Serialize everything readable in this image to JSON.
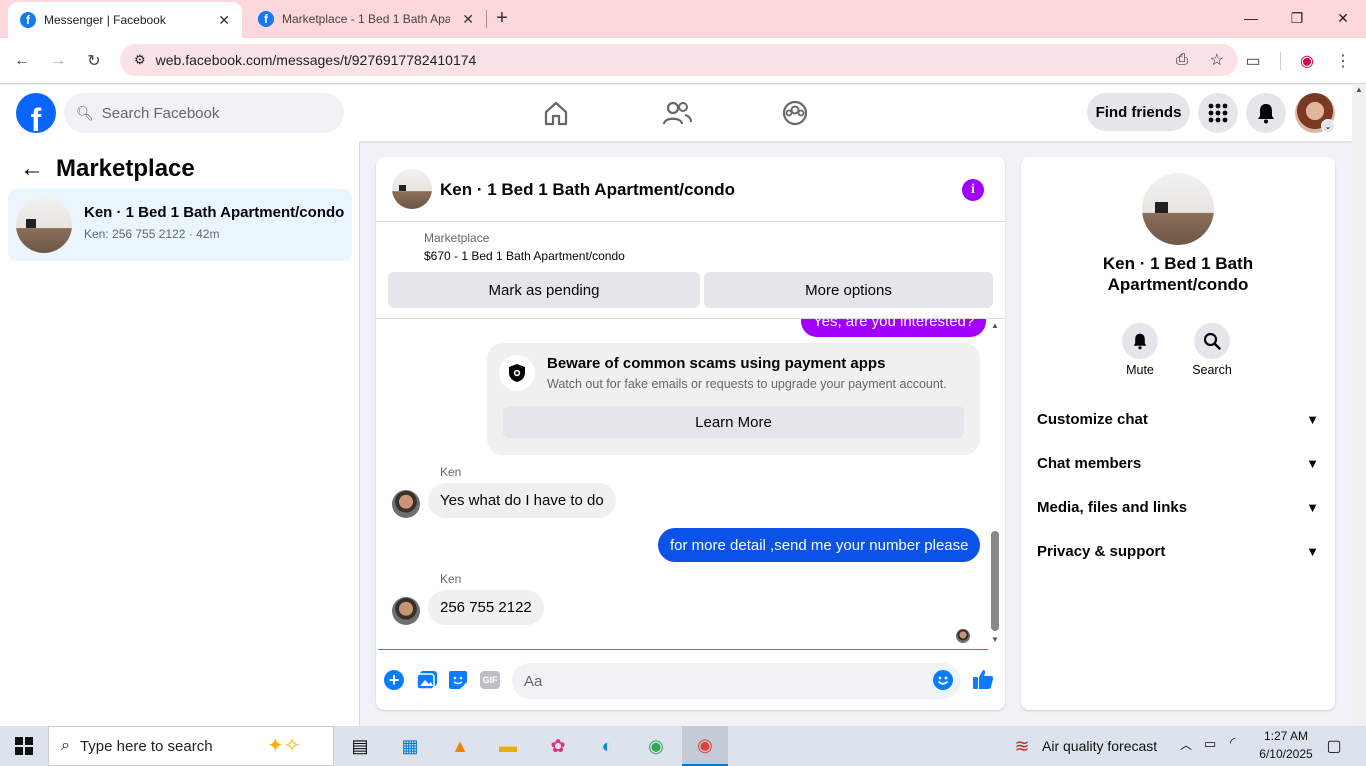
{
  "browser": {
    "tabs": [
      {
        "title": "Messenger | Facebook"
      },
      {
        "title": "Marketplace - 1 Bed 1 Bath Apa"
      }
    ],
    "url": "web.facebook.com/messages/t/9276917782410174"
  },
  "header": {
    "search_placeholder": "Search Facebook",
    "find_friends": "Find friends"
  },
  "left": {
    "title": "Marketplace",
    "conversation": {
      "name": "Ken · 1 Bed 1 Bath Apartment/condo",
      "preview": "Ken: 256 755 2122 · 42m"
    }
  },
  "chat": {
    "title": "Ken · 1 Bed 1 Bath Apartment/condo",
    "listing_source": "Marketplace",
    "listing": "$670 - 1 Bed 1 Bath Apartment/condo",
    "mark_pending": "Mark as pending",
    "more_options": "More options",
    "partial_message": "Yes, are you interested?",
    "scam_title": "Beware of common scams using payment apps",
    "scam_body": "Watch out for fake emails or requests to upgrade your payment account.",
    "learn_more": "Learn More",
    "messages": [
      {
        "sender": "Ken",
        "text": "Yes what do I have to do"
      },
      {
        "text": "for more detail ,send me your number please"
      },
      {
        "sender": "Ken",
        "text": "256 755 2122"
      }
    ],
    "composer_placeholder": "Aa",
    "composer_icons": {
      "gif": "GIF"
    }
  },
  "right": {
    "name": "Ken · 1 Bed 1 Bath Apartment/condo",
    "mute": "Mute",
    "search": "Search",
    "sections": [
      "Customize chat",
      "Chat members",
      "Media, files and links",
      "Privacy & support"
    ]
  },
  "taskbar": {
    "search_placeholder": "Type here to search",
    "weather": "Air quality forecast",
    "time": "1:27 AM",
    "date": "6/10/2025"
  },
  "colors": {
    "accent_purple": "#a100ff",
    "messenger_blue": "#0a52e8",
    "fb_blue": "#0866ff"
  }
}
